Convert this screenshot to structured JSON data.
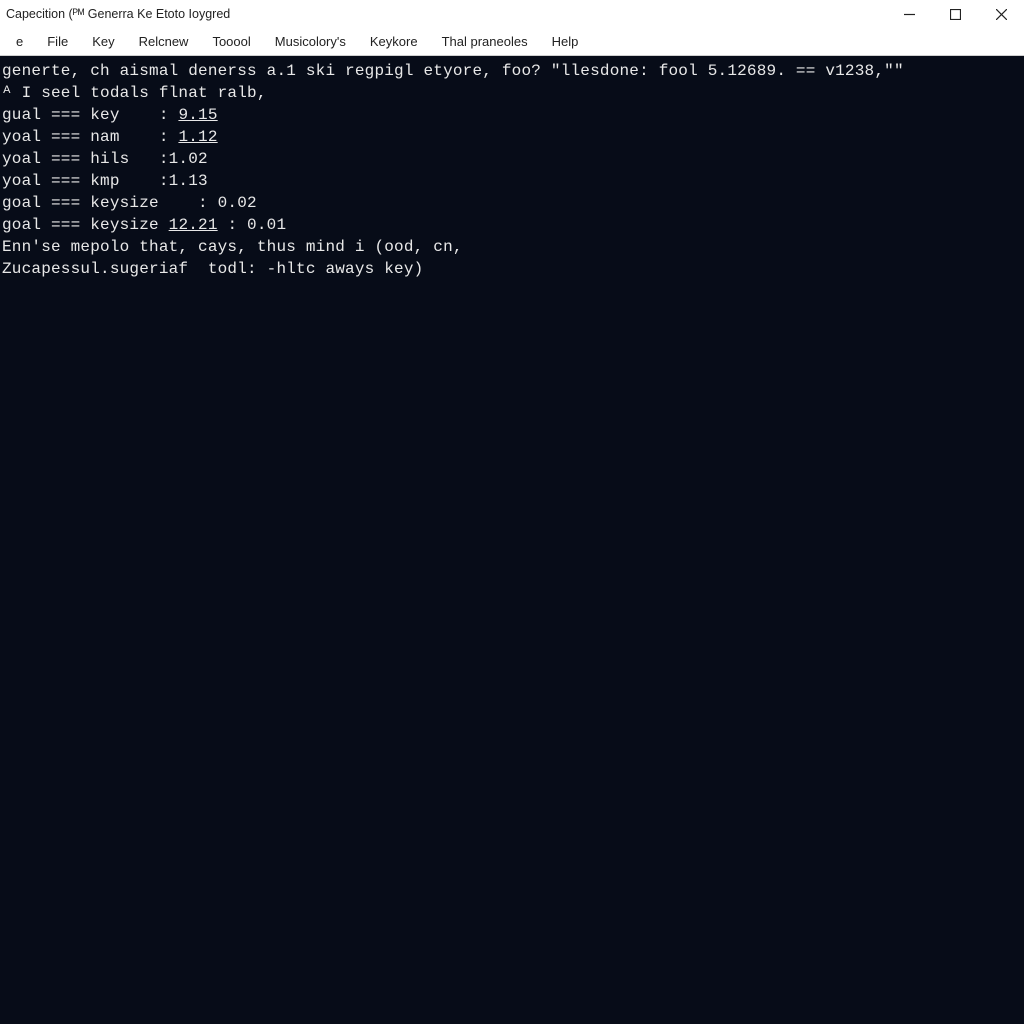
{
  "window": {
    "title": "Capecition (ᴾᴹ Generra Ke Etoto Ioygred"
  },
  "menubar": {
    "items": [
      {
        "label": "e"
      },
      {
        "label": "File"
      },
      {
        "label": "Key"
      },
      {
        "label": "Relcnew"
      },
      {
        "label": "Tooool"
      },
      {
        "label": "Musicolory's"
      },
      {
        "label": "Keykore"
      },
      {
        "label": "Thal praneoles"
      },
      {
        "label": "Help"
      }
    ]
  },
  "terminal": {
    "lines": [
      "generte, ch aismal denerss a.1 ski regpigl etyore, foo? \"llesdone: fool 5.12689. == v1238,\"\"",
      "ᴬ I seel todals flnat ralb,",
      "gual === key    : 9.15",
      "yoal === nam    : 1.12",
      "yoal === hils   :1.02",
      "yoal === kmp    :1.13",
      "goal === keysize    : 0.02",
      "goal === keysize 12.21 : 0.01",
      "",
      "Enn'se mepolo that, cays, thus mind i (ood, cn,",
      "",
      "Zucapessul.sugeriaf  todl: -hltc aways key)"
    ],
    "underline_targets": {
      "2": "9.15",
      "3": "1.12",
      "7": "12.21"
    }
  }
}
